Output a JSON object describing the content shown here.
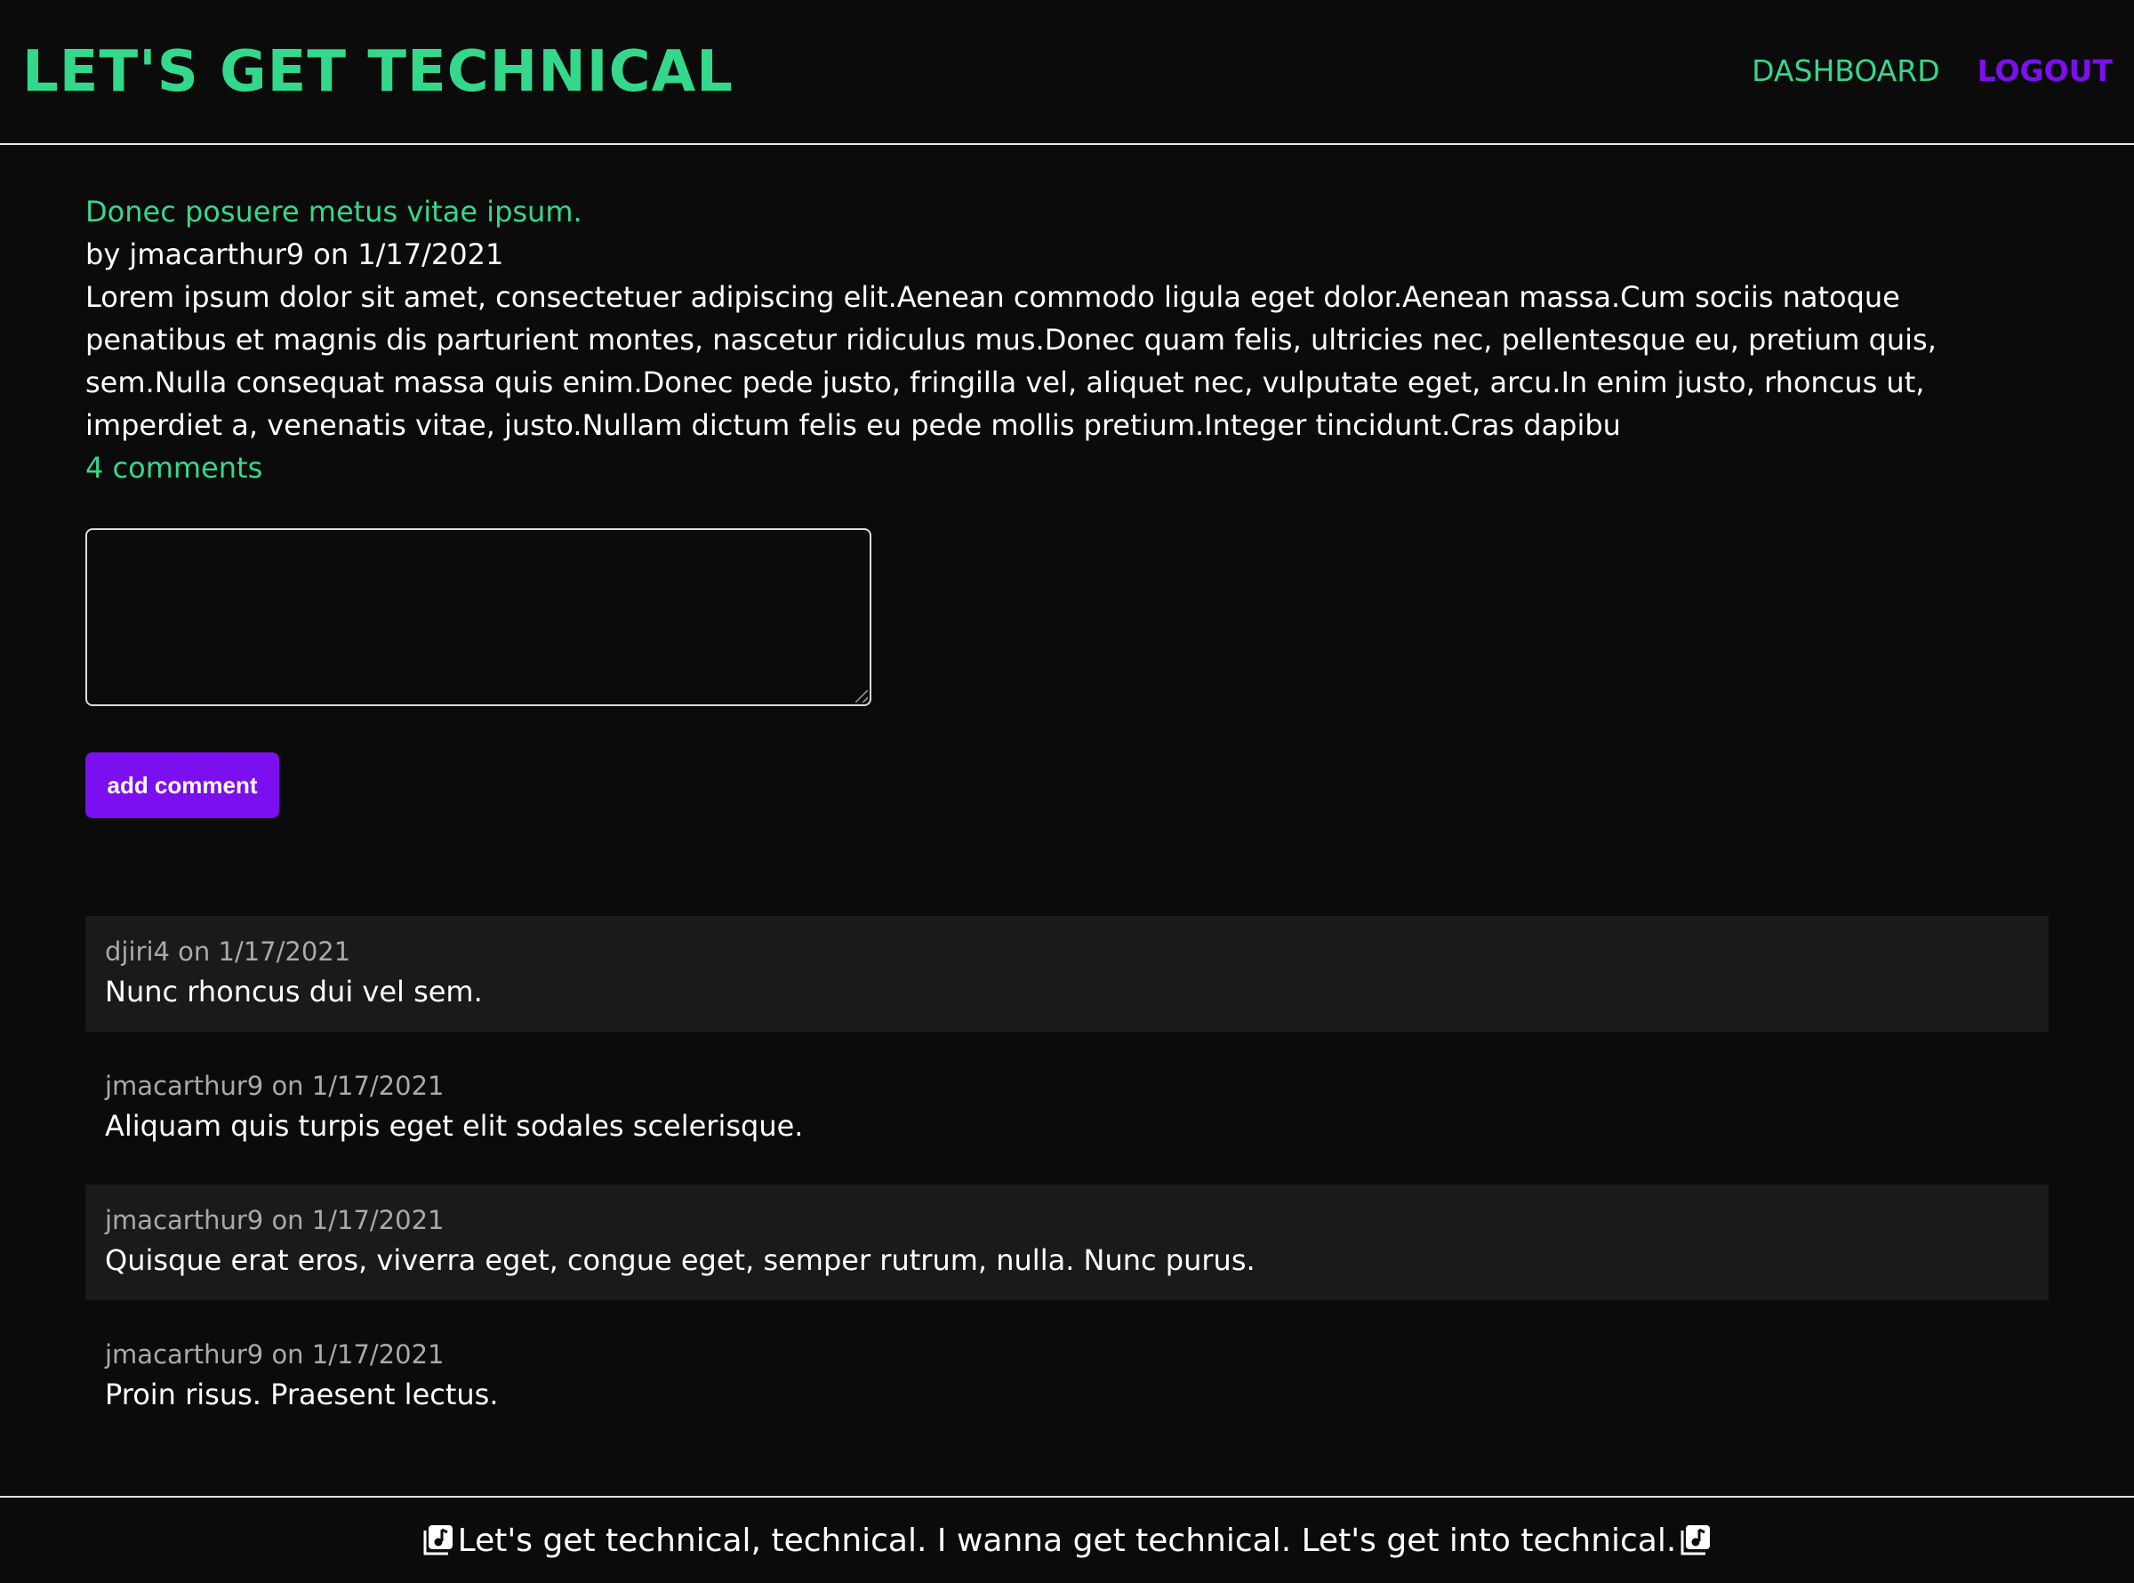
{
  "header": {
    "title": "LET'S GET TECHNICAL",
    "nav": {
      "dashboard": "DASHBOARD",
      "logout": "LOGOUT"
    }
  },
  "colors": {
    "accent_green": "#34d88a",
    "accent_purple": "#7b0ff0",
    "background": "#0b0b0b",
    "comment_shade": "#1b1a18"
  },
  "post": {
    "title": "Donec posuere metus vitae ipsum.",
    "meta": "by jmacarthur9 on 1/17/2021",
    "body": "Lorem ipsum dolor sit amet, consectetuer adipiscing elit.Aenean commodo ligula eget dolor.Aenean massa.Cum sociis natoque penatibus et magnis dis parturient montes, nascetur ridiculus mus.Donec quam felis, ultricies nec, pellentesque eu, pretium quis, sem.Nulla consequat massa quis enim.Donec pede justo, fringilla vel, aliquet nec, vulputate eget, arcu.In enim justo, rhoncus ut, imperdiet a, venenatis vitae, justo.Nullam dictum felis eu pede mollis pretium.Integer tincidunt.Cras dapibu",
    "comment_count": "4 comments"
  },
  "comment_form": {
    "value": "",
    "button_label": "add comment"
  },
  "comments": [
    {
      "meta": "djiri4 on 1/17/2021",
      "text": "Nunc rhoncus dui vel sem."
    },
    {
      "meta": "jmacarthur9 on 1/17/2021",
      "text": "Aliquam quis turpis eget elit sodales scelerisque."
    },
    {
      "meta": "jmacarthur9 on 1/17/2021",
      "text": "Quisque erat eros, viverra eget, congue eget, semper rutrum, nulla. Nunc purus."
    },
    {
      "meta": "jmacarthur9 on 1/17/2021",
      "text": "Proin risus. Praesent lectus."
    }
  ],
  "footer": {
    "text": "Let's get technical, technical. I wanna get technical. Let's get into technical.",
    "icon": "music-note-icon"
  }
}
